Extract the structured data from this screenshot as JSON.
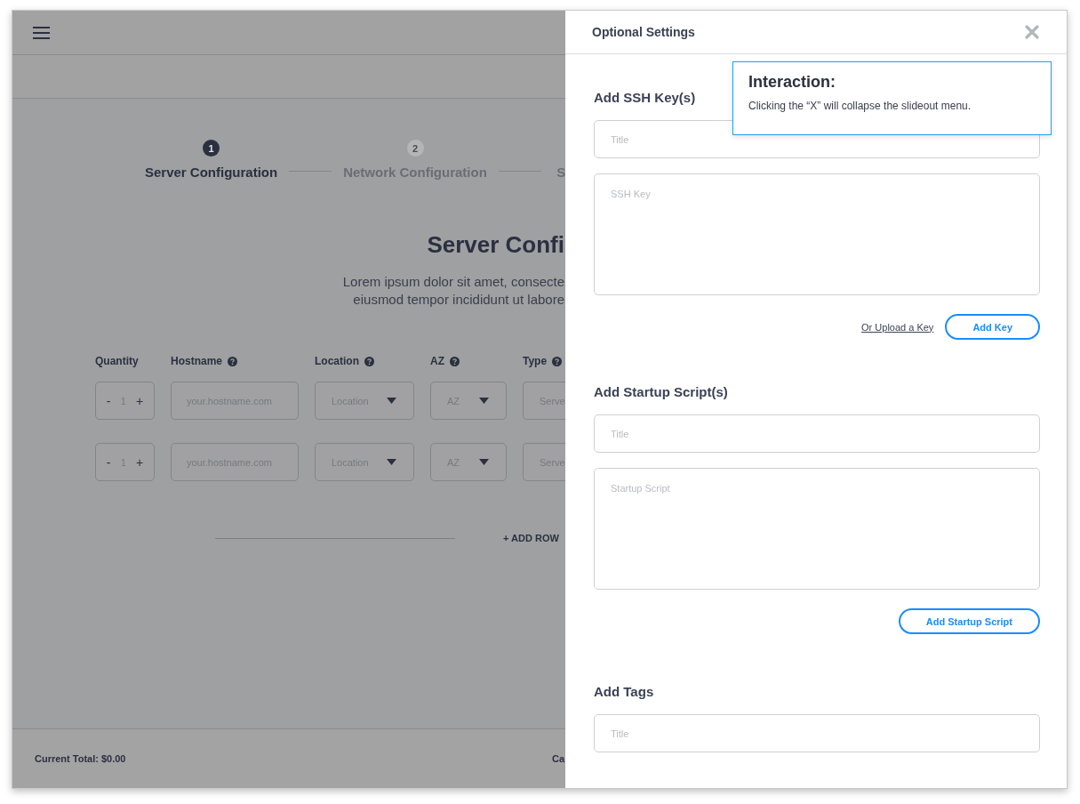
{
  "wizard": {
    "steps": [
      {
        "number": "1",
        "label": "Server Configuration",
        "selected": true
      },
      {
        "number": "2",
        "label": "Network Configuration",
        "selected": false
      },
      {
        "label": "S",
        "selected": false
      }
    ]
  },
  "heading": "Server Confi",
  "description": [
    "Lorem ipsum dolor sit amet, consecte",
    "eiusmod tempor incididunt ut labore"
  ],
  "columns": [
    {
      "label": "Quantity",
      "help": false
    },
    {
      "label": "Hostname",
      "help": true
    },
    {
      "label": "Location",
      "help": true
    },
    {
      "label": "AZ",
      "help": true
    },
    {
      "label": "Type",
      "help": true
    }
  ],
  "rows": [
    {
      "decrement": "-",
      "quantity": "1",
      "increment": "+",
      "hostname_placeholder": "your.hostname.com",
      "location": "Location",
      "az": "AZ",
      "type": "Serve"
    },
    {
      "decrement": "-",
      "quantity": "1",
      "increment": "+",
      "hostname_placeholder": "your.hostname.com",
      "location": "Location",
      "az": "AZ",
      "type": "Serve"
    }
  ],
  "add_row": "+ ADD ROW",
  "footer": {
    "total": "Current Total: $0.00",
    "button": "Ca"
  },
  "slideout": {
    "title": "Optional Settings",
    "sections": [
      {
        "heading": "Add SSH Key(s)",
        "title_placeholder": "Title",
        "body_placeholder": "SSH Key",
        "link": "Or Upload a Key",
        "button": "Add Key"
      },
      {
        "heading": "Add Startup Script(s)",
        "title_placeholder": "Title",
        "body_placeholder": "Startup Script",
        "button": "Add Startup Script"
      },
      {
        "heading": "Add Tags",
        "title_placeholder": "Title"
      }
    ]
  },
  "annotation": {
    "title": "Interaction:",
    "text": "Clicking the “X” will collapse the slideout menu."
  }
}
